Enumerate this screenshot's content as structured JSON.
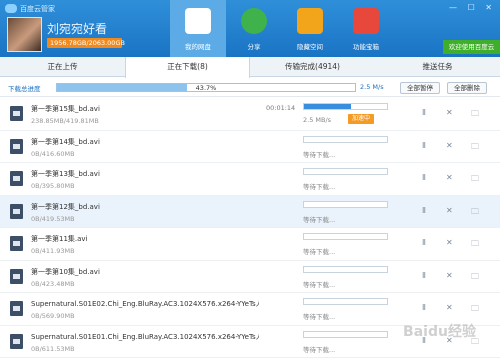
{
  "app": {
    "title": "百度云管家"
  },
  "window_controls": "— ☐ ✕",
  "user": {
    "name": "刘宛宛好看",
    "quota": "1956.78GB/2063.00GB"
  },
  "nav": [
    {
      "label": "我的网盘",
      "icon": "cloud-icon",
      "color": "#ffffff"
    },
    {
      "label": "分享",
      "icon": "share-icon",
      "color": "#3fb24b"
    },
    {
      "label": "隐藏空间",
      "icon": "lock-icon",
      "color": "#f2a41a"
    },
    {
      "label": "功能宝箱",
      "icon": "toolbox-icon",
      "color": "#e8473b"
    }
  ],
  "welcome_button": "欢迎使用百度云",
  "tabs": [
    {
      "label": "正在上传"
    },
    {
      "label": "正在下载(8)"
    },
    {
      "label": "传输完成(4914)"
    },
    {
      "label": "推送任务"
    }
  ],
  "total": {
    "label": "下载总进度",
    "percent_text": "43.7%",
    "progress": 0.437,
    "speed": "2.5 M/s",
    "pause_all": "全部暂停",
    "delete_all": "全部删除"
  },
  "rows": [
    {
      "name": "第一季第15集_bd.avi",
      "size": "238.85MB/419.81MB",
      "time": "00:01:14",
      "progress": 0.57,
      "status": "2.5 MB/s",
      "accel": "加速中",
      "highlight": false
    },
    {
      "name": "第一季第14集_bd.avi",
      "size": "0B/416.60MB",
      "time": "",
      "progress": 0,
      "status": "等待下载...",
      "accel": "",
      "highlight": false
    },
    {
      "name": "第一季第13集_bd.avi",
      "size": "0B/395.80MB",
      "time": "",
      "progress": 0,
      "status": "等待下载...",
      "accel": "",
      "highlight": false
    },
    {
      "name": "第一季第12集_bd.avi",
      "size": "0B/419.53MB",
      "time": "",
      "progress": 0,
      "status": "等待下载...",
      "accel": "",
      "highlight": true
    },
    {
      "name": "第一季第11集.avi",
      "size": "0B/411.93MB",
      "time": "",
      "progress": 0,
      "status": "等待下载...",
      "accel": "",
      "highlight": false
    },
    {
      "name": "第一季第10集_bd.avi",
      "size": "0B/423.48MB",
      "time": "",
      "progress": 0,
      "status": "等待下载...",
      "accel": "",
      "highlight": false
    },
    {
      "name": "Supernatural.S01E02.Chi_Eng.BluRay.AC3.1024X576.x264-YYeTs人人影视.mkv",
      "size": "0B/569.90MB",
      "time": "",
      "progress": 0,
      "status": "等待下载...",
      "accel": "",
      "highlight": false
    },
    {
      "name": "Supernatural.S01E01.Chi_Eng.BluRay.AC3.1024X576.x264-YYeTs人人影视.mkv",
      "size": "0B/611.53MB",
      "time": "",
      "progress": 0,
      "status": "等待下载...",
      "accel": "",
      "highlight": false
    }
  ],
  "row_controls": {
    "pause": "Ⅱ",
    "delete": "✕",
    "folder": "🗀"
  },
  "watermark": "Baidu经验"
}
